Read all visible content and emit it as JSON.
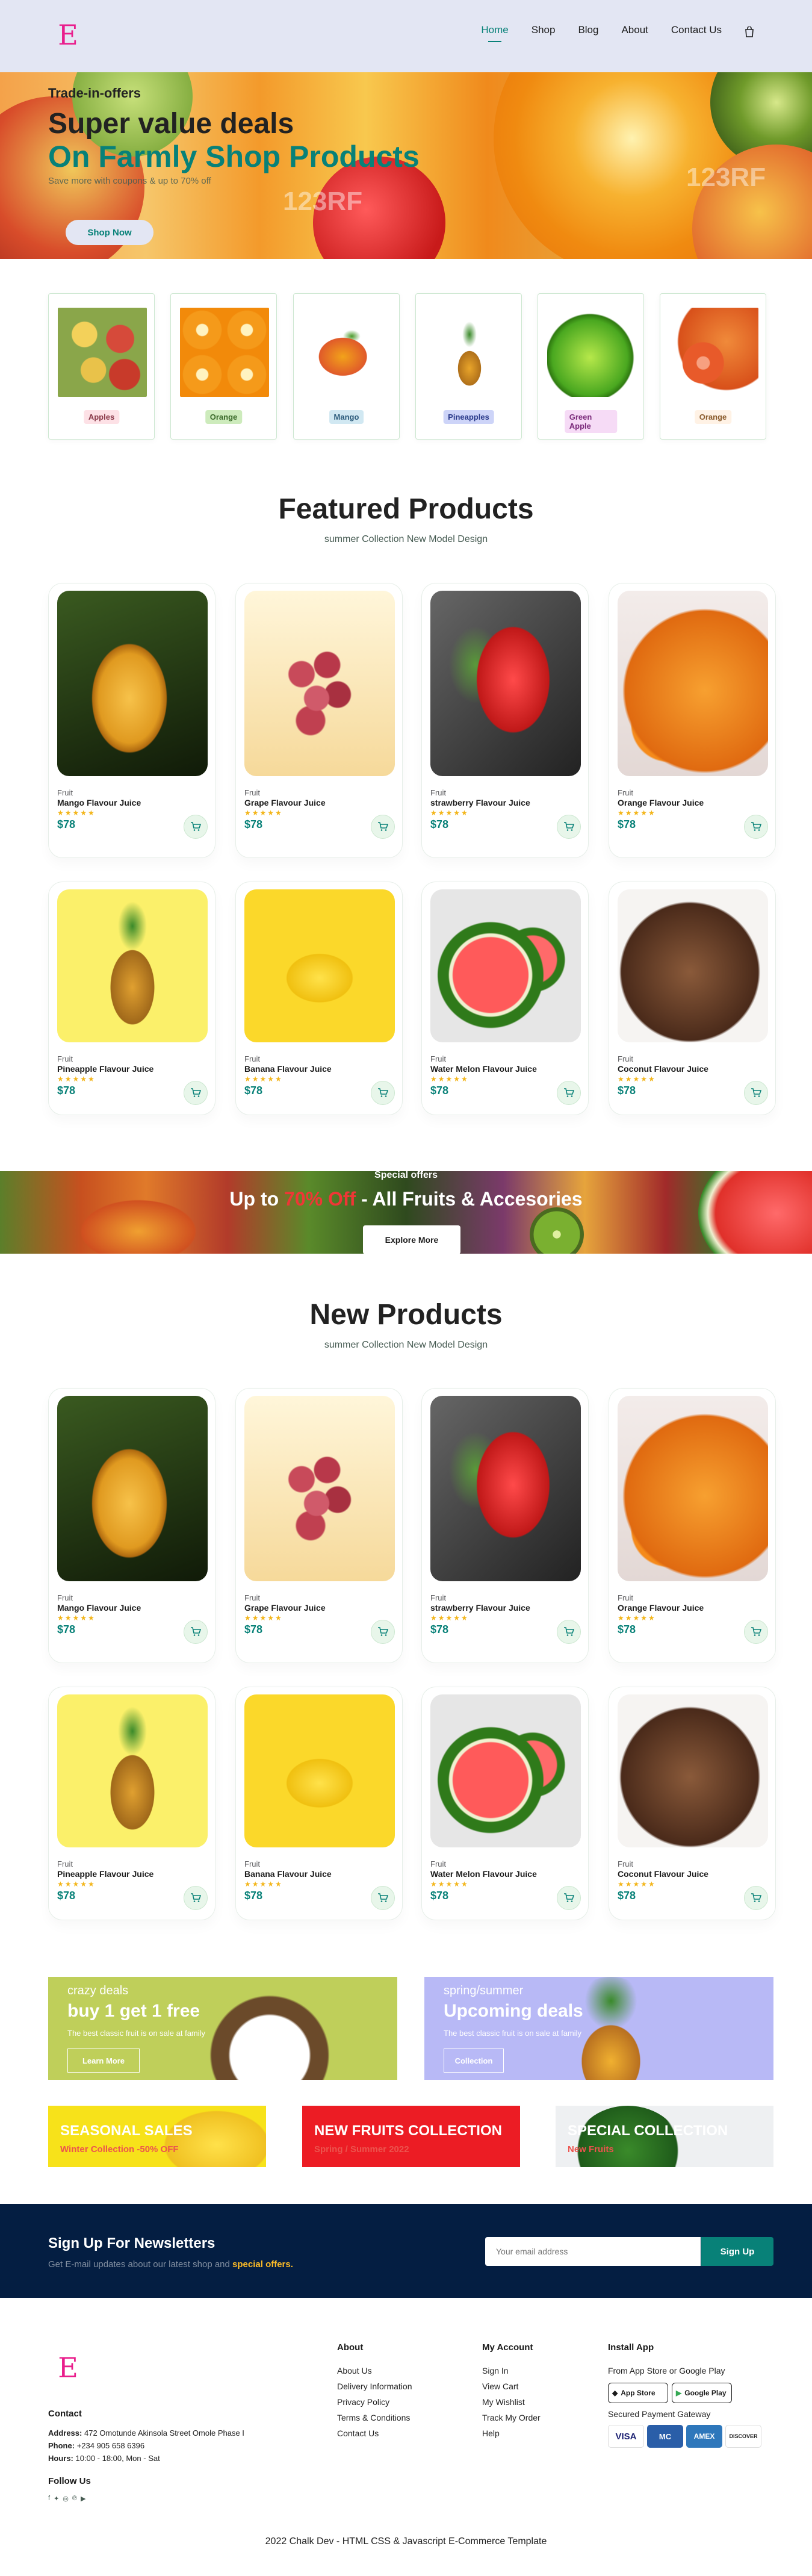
{
  "header": {
    "logo": "E",
    "nav": [
      "Home",
      "Shop",
      "Blog",
      "About",
      "Contact Us"
    ]
  },
  "hero": {
    "eyebrow": "Trade-in-offers",
    "title": "Super value deals",
    "highlight": "On Farmly Shop Products",
    "subtitle": "Save more with coupons & up to 70% off",
    "button": "Shop Now",
    "watermark": "123RF"
  },
  "categories": [
    {
      "label": "Apples",
      "tag_bg": "#fde1e6"
    },
    {
      "label": "Orange",
      "tag_bg": "#cdebbc"
    },
    {
      "label": "Mango",
      "tag_bg": "#d1e8f2"
    },
    {
      "label": "Pineapples",
      "tag_bg": "#cdd4f8"
    },
    {
      "label": "Green Apple",
      "tag_bg": "#f6dbf6"
    },
    {
      "label": "Orange",
      "tag_bg": "#fff2e5"
    }
  ],
  "featured": {
    "title": "Featured Products",
    "subtitle": "summer Collection New Model Design"
  },
  "new_products": {
    "title": "New Products",
    "subtitle": "summer Collection New Model Design"
  },
  "products": [
    {
      "brand": "Fruit",
      "name": "Mango Flavour Juice",
      "stars": "★★★★★",
      "price": "$78"
    },
    {
      "brand": "Fruit",
      "name": "Grape Flavour Juice",
      "stars": "★★★★★",
      "price": "$78"
    },
    {
      "brand": "Fruit",
      "name": "strawberry Flavour Juice",
      "stars": "★★★★★",
      "price": "$78"
    },
    {
      "brand": "Fruit",
      "name": "Orange Flavour Juice",
      "stars": "★★★★★",
      "price": "$78"
    },
    {
      "brand": "Fruit",
      "name": "Pineapple Flavour Juice",
      "stars": "★★★★★",
      "price": "$78"
    },
    {
      "brand": "Fruit",
      "name": "Banana Flavour Juice",
      "stars": "★★★★★",
      "price": "$78"
    },
    {
      "brand": "Fruit",
      "name": "Water Melon Flavour Juice",
      "stars": "★★★★★",
      "price": "$78"
    },
    {
      "brand": "Fruit",
      "name": "Coconut Flavour Juice",
      "stars": "★★★★★",
      "price": "$78"
    }
  ],
  "banner": {
    "eyebrow": "Special offers",
    "title_pre": "Up to ",
    "title_hl": "70% Off",
    "title_post": " - All Fruits & Accesories",
    "button": "Explore More"
  },
  "promo_big": [
    {
      "eyebrow": "crazy deals",
      "title": "buy 1 get 1 free",
      "text": "The best classic fruit is on sale at family",
      "button": "Learn More"
    },
    {
      "eyebrow": "spring/summer",
      "title": "Upcoming deals",
      "text": "The best classic fruit is on sale at family",
      "button": "Collection"
    }
  ],
  "promo_small": [
    {
      "title": "SEASONAL SALES",
      "text": "Winter Collection -50% OFF"
    },
    {
      "title": "NEW FRUITS COLLECTION",
      "text": "Spring / Summer 2022"
    },
    {
      "title": "SPECIAL COLLECTION",
      "text": "New Fruits"
    }
  ],
  "newsletter": {
    "title": "Sign Up For Newsletters",
    "text": "Get E-mail updates about our latest shop and ",
    "text_hl": "special offers.",
    "placeholder": "Your email address",
    "button": "Sign Up"
  },
  "footer": {
    "logo": "E",
    "contact_title": "Contact",
    "address_label": "Address:",
    "address": "472 Omotunde Akinsola Street Omole Phase I",
    "phone_label": "Phone:",
    "phone": "+234 905 658 6396",
    "hours_label": "Hours:",
    "hours": "10:00 - 18:00, Mon - Sat",
    "follow": "Follow Us",
    "about": {
      "title": "About",
      "links": [
        "About Us",
        "Delivery Information",
        "Privacy Policy",
        "Terms & Conditions",
        "Contact Us"
      ]
    },
    "account": {
      "title": "My Account",
      "links": [
        "Sign In",
        "View Cart",
        "My Wishlist",
        "Track My Order",
        "Help"
      ]
    },
    "install": {
      "title": "Install App",
      "stores_text": "From App Store or Google Play",
      "app_store": "App Store",
      "google_play": "Google Play",
      "gateway": "Secured Payment Gateway"
    },
    "payments": [
      "VISA",
      "MC",
      "AMEX",
      "DISCOVER"
    ],
    "copyright": "2022 Chalk Dev - HTML CSS & Javascript E-Commerce Template"
  },
  "colors": {
    "accent": "#088178",
    "brand": "#e91e8c",
    "star": "#f3b519",
    "dark": "#041e42"
  }
}
